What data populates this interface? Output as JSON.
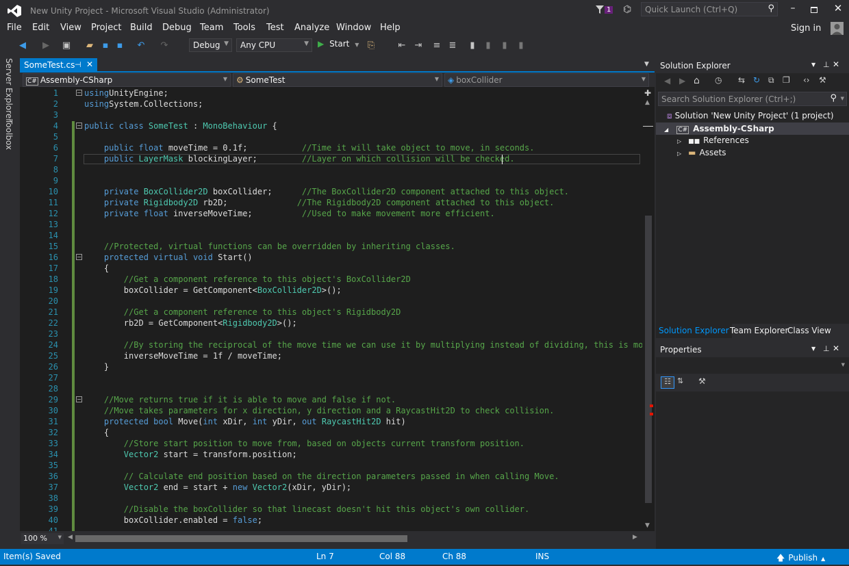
{
  "window": {
    "title": "New Unity Project - Microsoft Visual Studio (Administrator)",
    "notification_count": "1",
    "quick_launch_placeholder": "Quick Launch (Ctrl+Q)",
    "sign_in": "Sign in"
  },
  "menu": [
    "File",
    "Edit",
    "View",
    "Project",
    "Build",
    "Debug",
    "Team",
    "Tools",
    "Test",
    "Analyze",
    "Window",
    "Help"
  ],
  "toolbar": {
    "config": "Debug",
    "platform": "Any CPU",
    "start": "Start"
  },
  "left_tabs": [
    "Server Explorer",
    "Toolbox"
  ],
  "editor": {
    "tab": "SomeTest.cs",
    "nav_project": "Assembly-CSharp",
    "nav_class": "SomeTest",
    "nav_member": "boxCollider",
    "zoom": "100 %",
    "lines": [
      [
        [
          "kw",
          "using"
        ],
        [
          "",
          "UnityEngine;"
        ]
      ],
      [
        [
          "kw",
          "using"
        ],
        [
          "",
          "System.Collections;"
        ]
      ],
      [],
      [
        [
          "kw",
          "public class "
        ],
        [
          "ty",
          "SomeTest"
        ],
        [
          "",
          " : "
        ],
        [
          "ty",
          "MonoBehaviour"
        ],
        [
          "",
          " {"
        ]
      ],
      [],
      [
        [
          "",
          "    "
        ],
        [
          "kw",
          "public float"
        ],
        [
          "",
          " moveTime = 0.1f;           "
        ],
        [
          "cm",
          "//Time it will take object to move, in seconds."
        ]
      ],
      [
        [
          "",
          "    "
        ],
        [
          "kw",
          "public "
        ],
        [
          "ty",
          "LayerMask"
        ],
        [
          "",
          " blockingLayer;         "
        ],
        [
          "cm",
          "//Layer on which collision will be checked."
        ]
      ],
      [],
      [],
      [
        [
          "",
          "    "
        ],
        [
          "kw",
          "private "
        ],
        [
          "ty",
          "BoxCollider2D"
        ],
        [
          "",
          " boxCollider;      "
        ],
        [
          "cm",
          "//The BoxCollider2D component attached to this object."
        ]
      ],
      [
        [
          "",
          "    "
        ],
        [
          "kw",
          "private "
        ],
        [
          "ty",
          "Rigidbody2D"
        ],
        [
          "",
          " rb2D;              "
        ],
        [
          "cm",
          "//The Rigidbody2D component attached to this object."
        ]
      ],
      [
        [
          "",
          "    "
        ],
        [
          "kw",
          "private float"
        ],
        [
          "",
          " inverseMoveTime;          "
        ],
        [
          "cm",
          "//Used to make movement more efficient."
        ]
      ],
      [],
      [],
      [
        [
          "",
          "    "
        ],
        [
          "cm",
          "//Protected, virtual functions can be overridden by inheriting classes."
        ]
      ],
      [
        [
          "",
          "    "
        ],
        [
          "kw",
          "protected virtual void"
        ],
        [
          "",
          " Start()"
        ]
      ],
      [
        [
          "",
          "    {"
        ]
      ],
      [
        [
          "",
          "        "
        ],
        [
          "cm",
          "//Get a component reference to this object's BoxCollider2D"
        ]
      ],
      [
        [
          "",
          "        boxCollider = GetComponent<"
        ],
        [
          "ty",
          "BoxCollider2D"
        ],
        [
          "",
          ">();"
        ]
      ],
      [],
      [
        [
          "",
          "        "
        ],
        [
          "cm",
          "//Get a component reference to this object's Rigidbody2D"
        ]
      ],
      [
        [
          "",
          "        rb2D = GetComponent<"
        ],
        [
          "ty",
          "Rigidbody2D"
        ],
        [
          "",
          ">();"
        ]
      ],
      [],
      [
        [
          "",
          "        "
        ],
        [
          "cm",
          "//By storing the reciprocal of the move time we can use it by multiplying instead of dividing, this is more"
        ]
      ],
      [
        [
          "",
          "        inverseMoveTime = 1f / moveTime;"
        ]
      ],
      [
        [
          "",
          "    }"
        ]
      ],
      [],
      [],
      [
        [
          "",
          "    "
        ],
        [
          "cm",
          "//Move returns true if it is able to move and false if not."
        ]
      ],
      [
        [
          "",
          "    "
        ],
        [
          "cm",
          "//Move takes parameters for x direction, y direction and a RaycastHit2D to check collision."
        ]
      ],
      [
        [
          "",
          "    "
        ],
        [
          "kw",
          "protected bool"
        ],
        [
          "",
          " Move("
        ],
        [
          "kw",
          "int"
        ],
        [
          "",
          " xDir, "
        ],
        [
          "kw",
          "int"
        ],
        [
          "",
          " yDir, "
        ],
        [
          "kw",
          "out "
        ],
        [
          "ty",
          "RaycastHit2D"
        ],
        [
          "",
          " hit)"
        ]
      ],
      [
        [
          "",
          "    {"
        ]
      ],
      [
        [
          "",
          "        "
        ],
        [
          "cm",
          "//Store start position to move from, based on objects current transform position."
        ]
      ],
      [
        [
          "",
          "        "
        ],
        [
          "ty",
          "Vector2"
        ],
        [
          "",
          " start = transform.position;"
        ]
      ],
      [],
      [
        [
          "",
          "        "
        ],
        [
          "cm",
          "// Calculate end position based on the direction parameters passed in when calling Move."
        ]
      ],
      [
        [
          "",
          "        "
        ],
        [
          "ty",
          "Vector2"
        ],
        [
          "",
          " end = start + "
        ],
        [
          "kw",
          "new "
        ],
        [
          "ty",
          "Vector2"
        ],
        [
          "",
          "(xDir, yDir);"
        ]
      ],
      [],
      [
        [
          "",
          "        "
        ],
        [
          "cm",
          "//Disable the boxCollider so that linecast doesn't hit this object's own collider."
        ]
      ],
      [
        [
          "",
          "        boxCollider.enabled = "
        ],
        [
          "kw",
          "false"
        ],
        [
          "",
          ";"
        ]
      ],
      []
    ]
  },
  "solution_explorer": {
    "title": "Solution Explorer",
    "search_placeholder": "Search Solution Explorer (Ctrl+;)",
    "solution": "Solution 'New Unity Project' (1 project)",
    "project": "Assembly-CSharp",
    "items": [
      "References",
      "Assets"
    ],
    "bottom_tabs": [
      "Solution Explorer",
      "Team Explorer",
      "Class View"
    ]
  },
  "properties": {
    "title": "Properties"
  },
  "status": {
    "message": "Item(s) Saved",
    "ln": "Ln 7",
    "col": "Col 88",
    "ch": "Ch 88",
    "mode": "INS",
    "publish": "Publish"
  }
}
